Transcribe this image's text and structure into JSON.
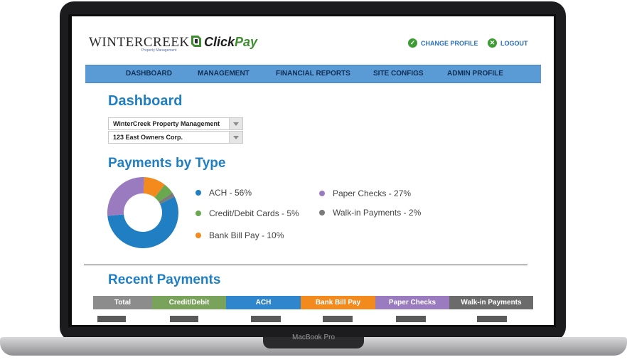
{
  "device": {
    "label": "MacBook Pro"
  },
  "header": {
    "logo_wintercreek": "WINTERCREEK",
    "logo_wintercreek_sub": "Property Management",
    "logo_clickpay_a": "Click",
    "logo_clickpay_b": "Pay",
    "links": [
      {
        "label": "CHANGE PROFILE",
        "icon": "check-icon"
      },
      {
        "label": "LOGOUT",
        "icon": "close-icon"
      }
    ]
  },
  "nav": {
    "items": [
      "DASHBOARD",
      "MANAGEMENT",
      "FINANCIAL REPORTS",
      "SITE CONFIGS",
      "ADMIN PROFILE"
    ],
    "color": "#5b9bd5"
  },
  "page": {
    "title": "Dashboard",
    "selects": [
      "WinterCreek Property Management",
      "123 East Owners Corp."
    ]
  },
  "payments_by_type": {
    "title": "Payments by Type",
    "legend": [
      {
        "label": "ACH - 56%",
        "color": "#1f7fc2"
      },
      {
        "label": "Credit/Debit Cards - 5%",
        "color": "#6aa84f"
      },
      {
        "label": "Bank Bill Pay - 10%",
        "color": "#f28a1e"
      },
      {
        "label": "Paper Checks - 27%",
        "color": "#9b7bc0"
      },
      {
        "label": "Walk-in Payments - 2%",
        "color": "#7a7a7a"
      }
    ]
  },
  "chart_data": {
    "type": "pie",
    "title": "Payments by Type",
    "categories": [
      "ACH",
      "Credit/Debit Cards",
      "Bank Bill Pay",
      "Paper Checks",
      "Walk-in Payments"
    ],
    "values": [
      56,
      5,
      10,
      27,
      2
    ],
    "colors": [
      "#1f7fc2",
      "#6aa84f",
      "#f28a1e",
      "#9b7bc0",
      "#7a7a7a"
    ],
    "donut": true
  },
  "recent_payments": {
    "title": "Recent Payments",
    "columns": [
      {
        "label": "Total",
        "color": "#8c8c8c"
      },
      {
        "label": "Credit/Debit",
        "color": "#79a35b"
      },
      {
        "label": "ACH",
        "color": "#2f86cc"
      },
      {
        "label": "Bank Bill Pay",
        "color": "#f28a1e"
      },
      {
        "label": "Paper Checks",
        "color": "#9b7bc0"
      },
      {
        "label": "Walk-in Payments",
        "color": "#6b6b6b"
      }
    ]
  }
}
